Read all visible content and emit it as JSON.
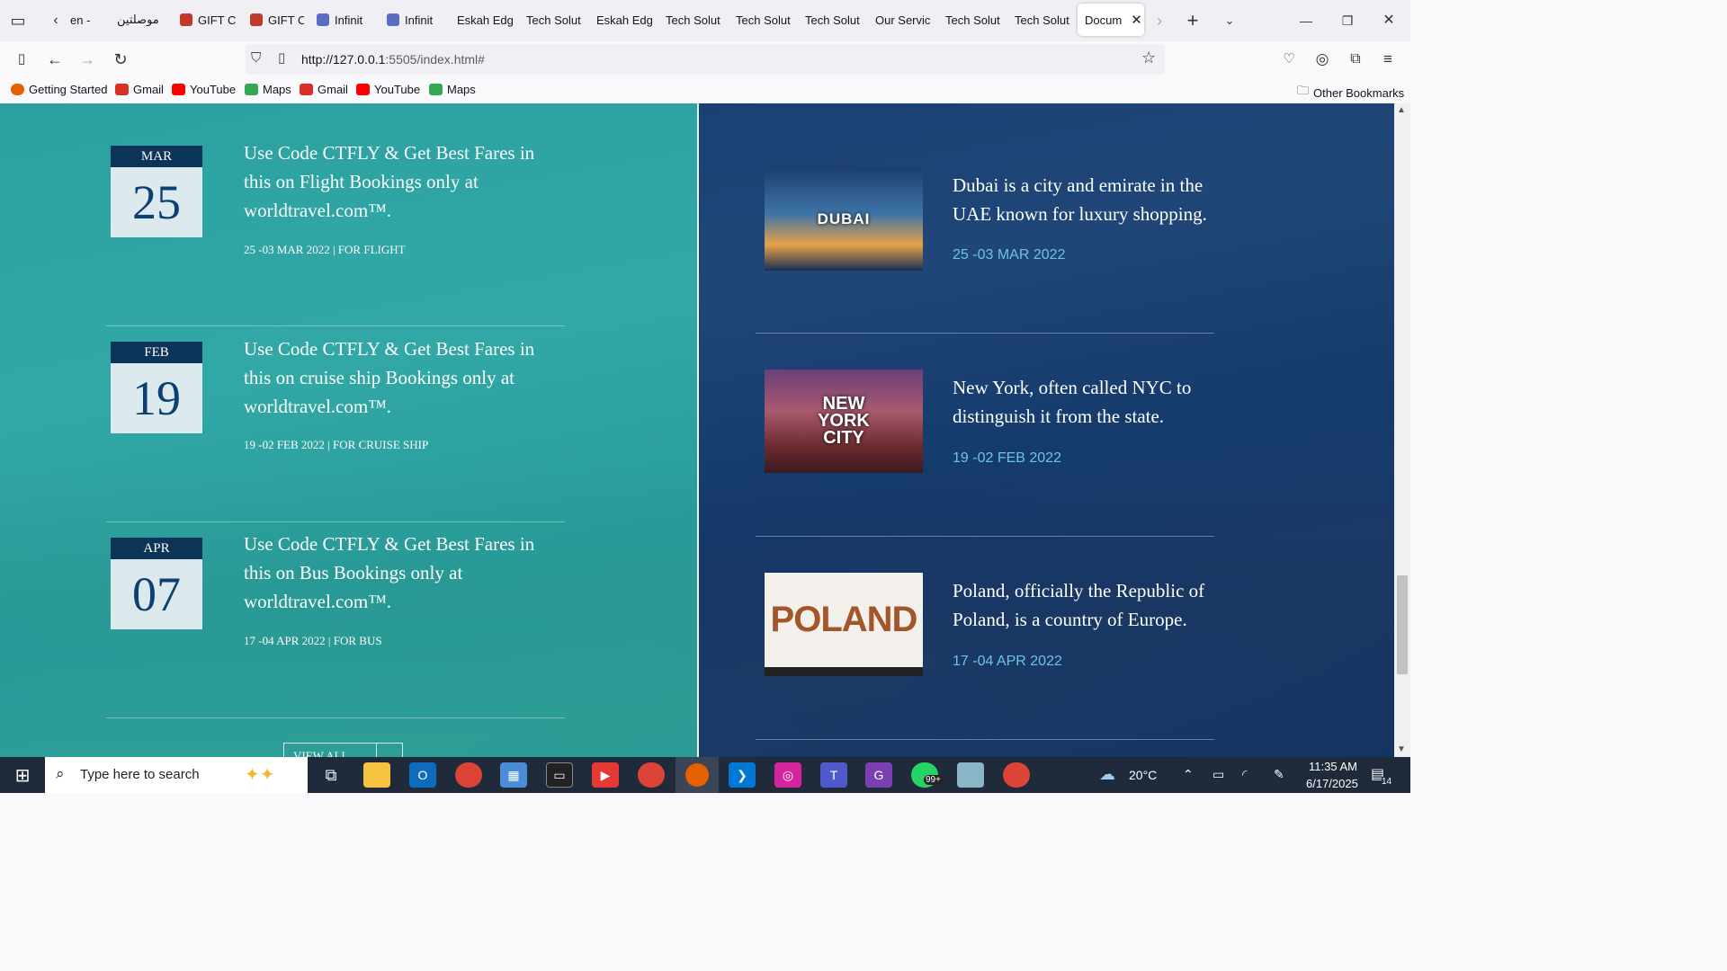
{
  "browser": {
    "tabs": [
      {
        "label": "en -",
        "color": "#888888"
      },
      {
        "label": "موصلتين",
        "color": "#888888"
      },
      {
        "label": "GIFT C",
        "color": "#c0392b"
      },
      {
        "label": "GIFT C",
        "color": "#c0392b"
      },
      {
        "label": "Infinit",
        "color": "#5b6cc4"
      },
      {
        "label": "Infinit",
        "color": "#5b6cc4"
      },
      {
        "label": "Eskah Edg",
        "color": ""
      },
      {
        "label": "Tech Solut",
        "color": ""
      },
      {
        "label": "Eskah Edg",
        "color": ""
      },
      {
        "label": "Tech Solut",
        "color": ""
      },
      {
        "label": "Tech Solut",
        "color": ""
      },
      {
        "label": "Tech Solut",
        "color": ""
      },
      {
        "label": "Our Servic",
        "color": ""
      },
      {
        "label": "Tech Solut",
        "color": ""
      },
      {
        "label": "Tech Solut",
        "color": ""
      },
      {
        "label": "Docum",
        "color": "",
        "active": true
      }
    ],
    "url_host": "http://127.0.0.1",
    "url_rest": ":5505/index.html#",
    "bookmarks": [
      {
        "label": "Getting Started",
        "icon": "firefox-icon",
        "color": "#e66000"
      },
      {
        "label": "Gmail",
        "icon": "gmail-icon",
        "color": "#d93025"
      },
      {
        "label": "YouTube",
        "icon": "youtube-icon",
        "color": "#ff0000"
      },
      {
        "label": "Maps",
        "icon": "maps-icon",
        "color": "#34a853"
      },
      {
        "label": "Gmail",
        "icon": "gmail-icon",
        "color": "#d93025"
      },
      {
        "label": "YouTube",
        "icon": "youtube-icon",
        "color": "#ff0000"
      },
      {
        "label": "Maps",
        "icon": "maps-icon",
        "color": "#34a853"
      }
    ],
    "other_bookmarks": "Other Bookmarks"
  },
  "deals": [
    {
      "month": "MAR",
      "day": "25",
      "text": "Use Code CTFLY & Get Best Fares in this on Flight Bookings only at worldtravel.com™.",
      "meta": "25 -03 MAR 2022 | FOR FLIGHT"
    },
    {
      "month": "FEB",
      "day": "19",
      "text": "Use Code CTFLY & Get Best Fares in this on cruise ship Bookings only at worldtravel.com™.",
      "meta": "19 -02 FEB 2022 | FOR CRUISE SHIP"
    },
    {
      "month": "APR",
      "day": "07",
      "text": "Use Code CTFLY & Get Best Fares in this on Bus Bookings only at worldtravel.com™.",
      "meta": "17 -04 APR 2022 | FOR BUS"
    }
  ],
  "view_all": "VIEW ALL",
  "destinations": [
    {
      "image_text": "DUBAI",
      "text": "Dubai is a city and emirate in the UAE known for luxury shopping.",
      "date": "25 -03 MAR 2022"
    },
    {
      "image_text": "NEW YORK CITY",
      "text": "New York, often called NYC to distinguish it from the state.",
      "date": "19 -02 FEB 2022"
    },
    {
      "image_text": "POLAND",
      "text": "Poland, officially the Republic of Poland, is a country of Europe.",
      "date": "17 -04 APR 2022"
    }
  ],
  "taskbar": {
    "search_placeholder": "Type here to search",
    "weather": "20°C",
    "time": "11:35 AM",
    "date": "6/17/2025",
    "whatsapp_badge": "99+",
    "notification_count": "14"
  }
}
